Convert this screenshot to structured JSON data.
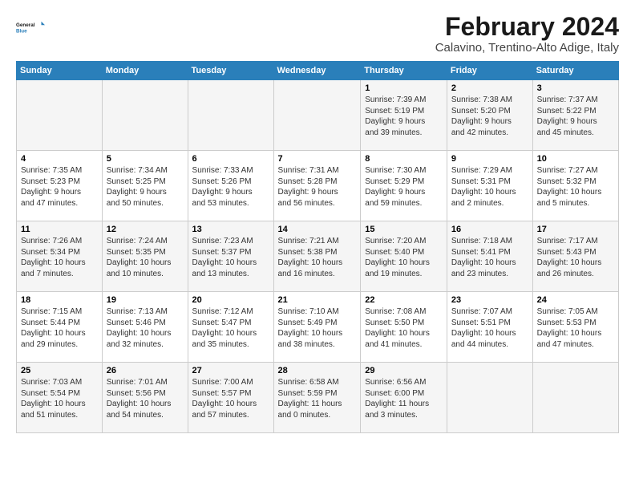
{
  "logo": {
    "line1": "General",
    "line2": "Blue"
  },
  "title": "February 2024",
  "location": "Calavino, Trentino-Alto Adige, Italy",
  "days_of_week": [
    "Sunday",
    "Monday",
    "Tuesday",
    "Wednesday",
    "Thursday",
    "Friday",
    "Saturday"
  ],
  "weeks": [
    [
      {
        "num": "",
        "info": ""
      },
      {
        "num": "",
        "info": ""
      },
      {
        "num": "",
        "info": ""
      },
      {
        "num": "",
        "info": ""
      },
      {
        "num": "1",
        "info": "Sunrise: 7:39 AM\nSunset: 5:19 PM\nDaylight: 9 hours\nand 39 minutes."
      },
      {
        "num": "2",
        "info": "Sunrise: 7:38 AM\nSunset: 5:20 PM\nDaylight: 9 hours\nand 42 minutes."
      },
      {
        "num": "3",
        "info": "Sunrise: 7:37 AM\nSunset: 5:22 PM\nDaylight: 9 hours\nand 45 minutes."
      }
    ],
    [
      {
        "num": "4",
        "info": "Sunrise: 7:35 AM\nSunset: 5:23 PM\nDaylight: 9 hours\nand 47 minutes."
      },
      {
        "num": "5",
        "info": "Sunrise: 7:34 AM\nSunset: 5:25 PM\nDaylight: 9 hours\nand 50 minutes."
      },
      {
        "num": "6",
        "info": "Sunrise: 7:33 AM\nSunset: 5:26 PM\nDaylight: 9 hours\nand 53 minutes."
      },
      {
        "num": "7",
        "info": "Sunrise: 7:31 AM\nSunset: 5:28 PM\nDaylight: 9 hours\nand 56 minutes."
      },
      {
        "num": "8",
        "info": "Sunrise: 7:30 AM\nSunset: 5:29 PM\nDaylight: 9 hours\nand 59 minutes."
      },
      {
        "num": "9",
        "info": "Sunrise: 7:29 AM\nSunset: 5:31 PM\nDaylight: 10 hours\nand 2 minutes."
      },
      {
        "num": "10",
        "info": "Sunrise: 7:27 AM\nSunset: 5:32 PM\nDaylight: 10 hours\nand 5 minutes."
      }
    ],
    [
      {
        "num": "11",
        "info": "Sunrise: 7:26 AM\nSunset: 5:34 PM\nDaylight: 10 hours\nand 7 minutes."
      },
      {
        "num": "12",
        "info": "Sunrise: 7:24 AM\nSunset: 5:35 PM\nDaylight: 10 hours\nand 10 minutes."
      },
      {
        "num": "13",
        "info": "Sunrise: 7:23 AM\nSunset: 5:37 PM\nDaylight: 10 hours\nand 13 minutes."
      },
      {
        "num": "14",
        "info": "Sunrise: 7:21 AM\nSunset: 5:38 PM\nDaylight: 10 hours\nand 16 minutes."
      },
      {
        "num": "15",
        "info": "Sunrise: 7:20 AM\nSunset: 5:40 PM\nDaylight: 10 hours\nand 19 minutes."
      },
      {
        "num": "16",
        "info": "Sunrise: 7:18 AM\nSunset: 5:41 PM\nDaylight: 10 hours\nand 23 minutes."
      },
      {
        "num": "17",
        "info": "Sunrise: 7:17 AM\nSunset: 5:43 PM\nDaylight: 10 hours\nand 26 minutes."
      }
    ],
    [
      {
        "num": "18",
        "info": "Sunrise: 7:15 AM\nSunset: 5:44 PM\nDaylight: 10 hours\nand 29 minutes."
      },
      {
        "num": "19",
        "info": "Sunrise: 7:13 AM\nSunset: 5:46 PM\nDaylight: 10 hours\nand 32 minutes."
      },
      {
        "num": "20",
        "info": "Sunrise: 7:12 AM\nSunset: 5:47 PM\nDaylight: 10 hours\nand 35 minutes."
      },
      {
        "num": "21",
        "info": "Sunrise: 7:10 AM\nSunset: 5:49 PM\nDaylight: 10 hours\nand 38 minutes."
      },
      {
        "num": "22",
        "info": "Sunrise: 7:08 AM\nSunset: 5:50 PM\nDaylight: 10 hours\nand 41 minutes."
      },
      {
        "num": "23",
        "info": "Sunrise: 7:07 AM\nSunset: 5:51 PM\nDaylight: 10 hours\nand 44 minutes."
      },
      {
        "num": "24",
        "info": "Sunrise: 7:05 AM\nSunset: 5:53 PM\nDaylight: 10 hours\nand 47 minutes."
      }
    ],
    [
      {
        "num": "25",
        "info": "Sunrise: 7:03 AM\nSunset: 5:54 PM\nDaylight: 10 hours\nand 51 minutes."
      },
      {
        "num": "26",
        "info": "Sunrise: 7:01 AM\nSunset: 5:56 PM\nDaylight: 10 hours\nand 54 minutes."
      },
      {
        "num": "27",
        "info": "Sunrise: 7:00 AM\nSunset: 5:57 PM\nDaylight: 10 hours\nand 57 minutes."
      },
      {
        "num": "28",
        "info": "Sunrise: 6:58 AM\nSunset: 5:59 PM\nDaylight: 11 hours\nand 0 minutes."
      },
      {
        "num": "29",
        "info": "Sunrise: 6:56 AM\nSunset: 6:00 PM\nDaylight: 11 hours\nand 3 minutes."
      },
      {
        "num": "",
        "info": ""
      },
      {
        "num": "",
        "info": ""
      }
    ]
  ]
}
